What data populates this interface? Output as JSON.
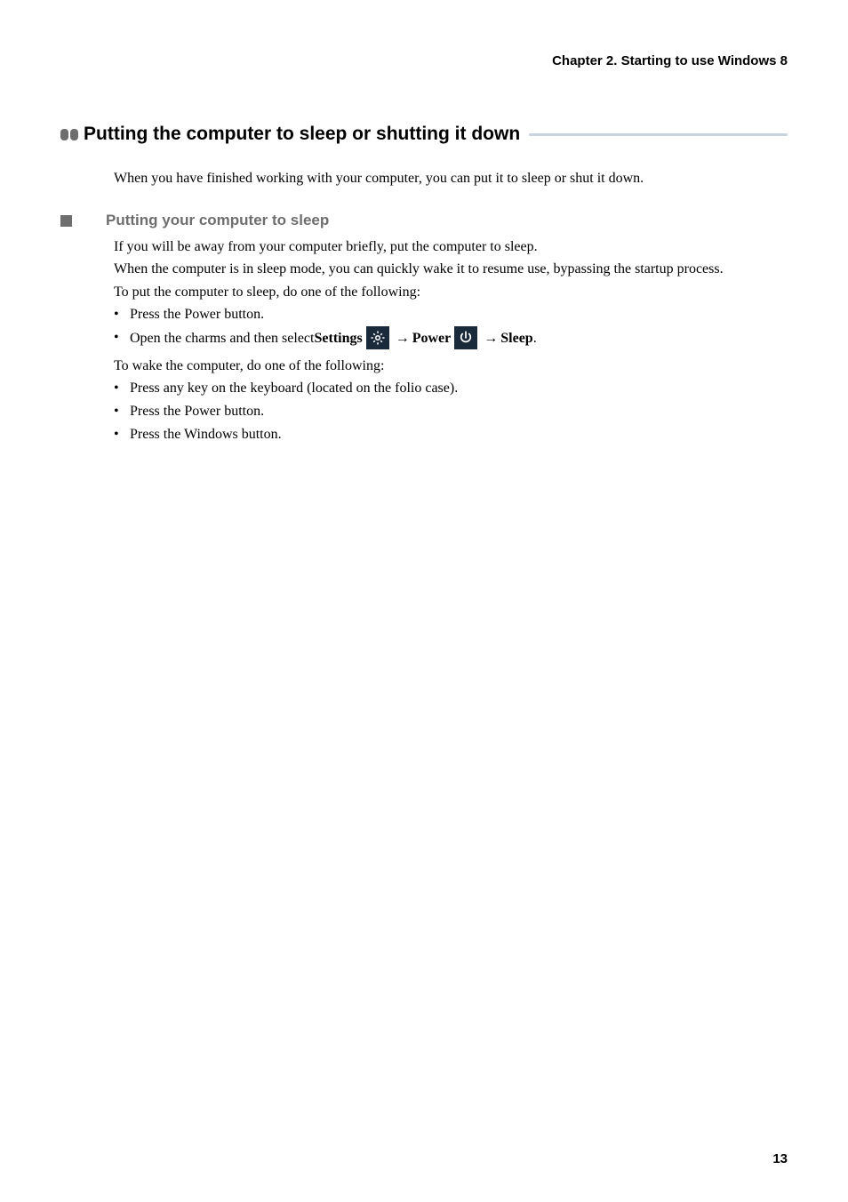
{
  "chapter_header": "Chapter 2. Starting to use Windows 8",
  "section_title": "Putting the computer to sleep or shutting it down",
  "intro": "When you have finished working with your computer, you can put it to sleep or shut it down.",
  "subsection_title": "Putting your computer to sleep",
  "body": {
    "p1": "If you will be away from your computer briefly, put the computer to sleep.",
    "p2": "When the computer is in sleep mode, you can quickly wake it to resume use, bypassing the startup process.",
    "p3": "To put the computer to sleep, do one of the following:",
    "bullets_sleep": [
      "Press the Power button."
    ],
    "charms_prefix": "Open the charms and then select ",
    "settings_label": "Settings",
    "power_label": "Power",
    "sleep_label": "Sleep",
    "arrow": "→",
    "p4": "To wake the computer, do one of the following:",
    "bullets_wake": [
      "Press any key on the keyboard (located on the folio case).",
      "Press the Power button.",
      "Press the Windows button."
    ]
  },
  "icons": {
    "settings": "settings-gear-icon",
    "power": "power-icon"
  },
  "page_number": "13"
}
